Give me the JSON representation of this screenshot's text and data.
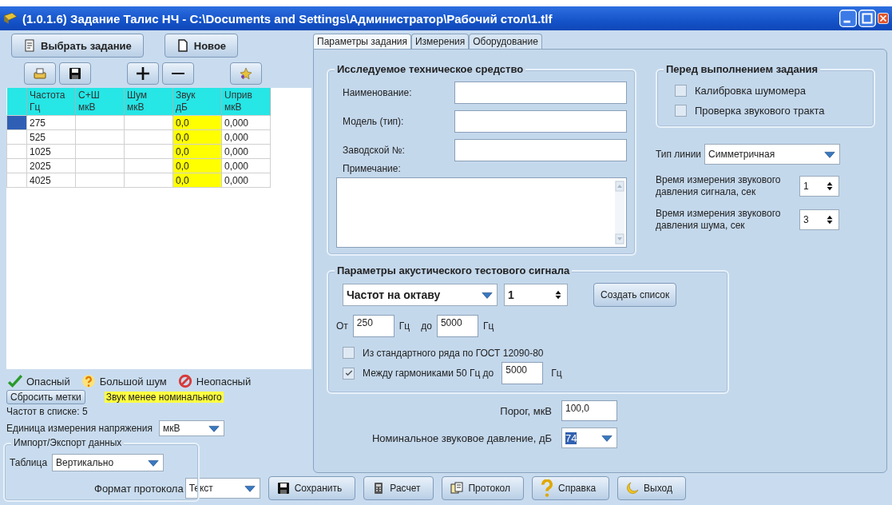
{
  "window": {
    "title": "(1.0.1.6) Задание Талис НЧ - C:\\Documents and Settings\\Администратор\\Рабочий стол\\1.tlf"
  },
  "toolbar": {
    "buttons": [
      {
        "label": "Выбрать задание",
        "kind": "document"
      },
      {
        "label": "Новое",
        "kind": "new"
      }
    ],
    "icon_groups": [
      [
        {
          "kind": "open"
        },
        {
          "kind": "save"
        }
      ],
      [
        {
          "kind": "add"
        },
        {
          "kind": "remove"
        }
      ],
      [
        {
          "kind": "wizard"
        }
      ]
    ]
  },
  "table": {
    "columns": [
      {
        "title": "Частота",
        "unit": "Гц"
      },
      {
        "title": "С+Ш",
        "unit": "мкВ"
      },
      {
        "title": "Шум",
        "unit": "мкВ"
      },
      {
        "title": "Звук",
        "unit": "дБ"
      },
      {
        "title": "Uприв",
        "unit": "мкВ"
      }
    ],
    "rows": [
      {
        "selected": true,
        "low_sound": true,
        "cells": [
          "275",
          null,
          null,
          "0,0",
          "0,000"
        ]
      },
      {
        "selected": false,
        "low_sound": true,
        "cells": [
          "525",
          null,
          null,
          "0,0",
          "0,000"
        ]
      },
      {
        "selected": false,
        "low_sound": true,
        "cells": [
          "1025",
          null,
          null,
          "0,0",
          "0,000"
        ]
      },
      {
        "selected": false,
        "low_sound": true,
        "cells": [
          "2025",
          null,
          null,
          "0,0",
          "0,000"
        ]
      },
      {
        "selected": false,
        "low_sound": true,
        "cells": [
          "4025",
          null,
          null,
          "0,0",
          "0,000"
        ]
      }
    ]
  },
  "legend": [
    {
      "kind": "check",
      "label": "Опасный"
    },
    {
      "kind": "question",
      "label": "Большой шум"
    },
    {
      "kind": "forbidden",
      "label": "Неопасный"
    }
  ],
  "reset_button": "Сбросить метки",
  "sound_note": "Звук менее номинального",
  "count": "Частот в списке: 5",
  "unit": {
    "label": "Единица измерения напряжения",
    "value": "мкВ"
  },
  "import_export": {
    "title": "Импорт/Экспорт данных",
    "label": "Таблица",
    "value": "Вертикально"
  },
  "tabs": [
    {
      "label": "Параметры задания",
      "selected": true
    },
    {
      "label": "Измерения",
      "selected": false
    },
    {
      "label": "Оборудование",
      "selected": false
    }
  ],
  "device": {
    "title": "Исследуемое техническое средство",
    "fields": [
      {
        "label": "Наименование:"
      },
      {
        "label": "Модель (тип):"
      },
      {
        "label": "Заводской №:"
      }
    ],
    "note_label": "Примечание:"
  },
  "before": {
    "title": "Перед выполнением задания",
    "checks": [
      {
        "label": "Калибровка шумомера",
        "checked": false
      },
      {
        "label": "Проверка звукового тракта",
        "checked": false
      }
    ]
  },
  "line_type": {
    "label": "Тип линии",
    "value": "Симметричная"
  },
  "times": [
    {
      "label": "Время измерения звукового давления сигнала, сек",
      "value": "1"
    },
    {
      "label": "Время измерения звукового давления шума, сек",
      "value": "3"
    }
  ],
  "signal": {
    "title": "Параметры акустического тестового сигнала",
    "mode": "Частот на октаву",
    "count": "1",
    "create_button": "Создать список",
    "from_label": "От",
    "from": "250",
    "from_unit": "Гц",
    "to_label": "до",
    "to": "5000",
    "to_unit": "Гц",
    "checks": [
      {
        "label": "Из стандартного ряда по ГОСТ 12090-80",
        "checked": false
      },
      {
        "label": "Между гармониками 50 Гц до",
        "checked": true,
        "value": "5000",
        "unit": "Гц"
      }
    ]
  },
  "threshold": {
    "label": "Порог, мкВ",
    "value": "100,0"
  },
  "nominal": {
    "label": "Номинальное звуковое давление, дБ",
    "value": "74",
    "text_selected": true
  },
  "bottom": {
    "format_label": "Формат протокола",
    "format_value": "Текст",
    "buttons": [
      {
        "label": "Сохранить",
        "kind": "save"
      },
      {
        "label": "Расчет",
        "kind": "calculator"
      },
      {
        "label": "Протокол",
        "kind": "report"
      },
      {
        "label": "Справка",
        "kind": "help"
      },
      {
        "label": "Выход",
        "kind": "moon"
      }
    ]
  }
}
